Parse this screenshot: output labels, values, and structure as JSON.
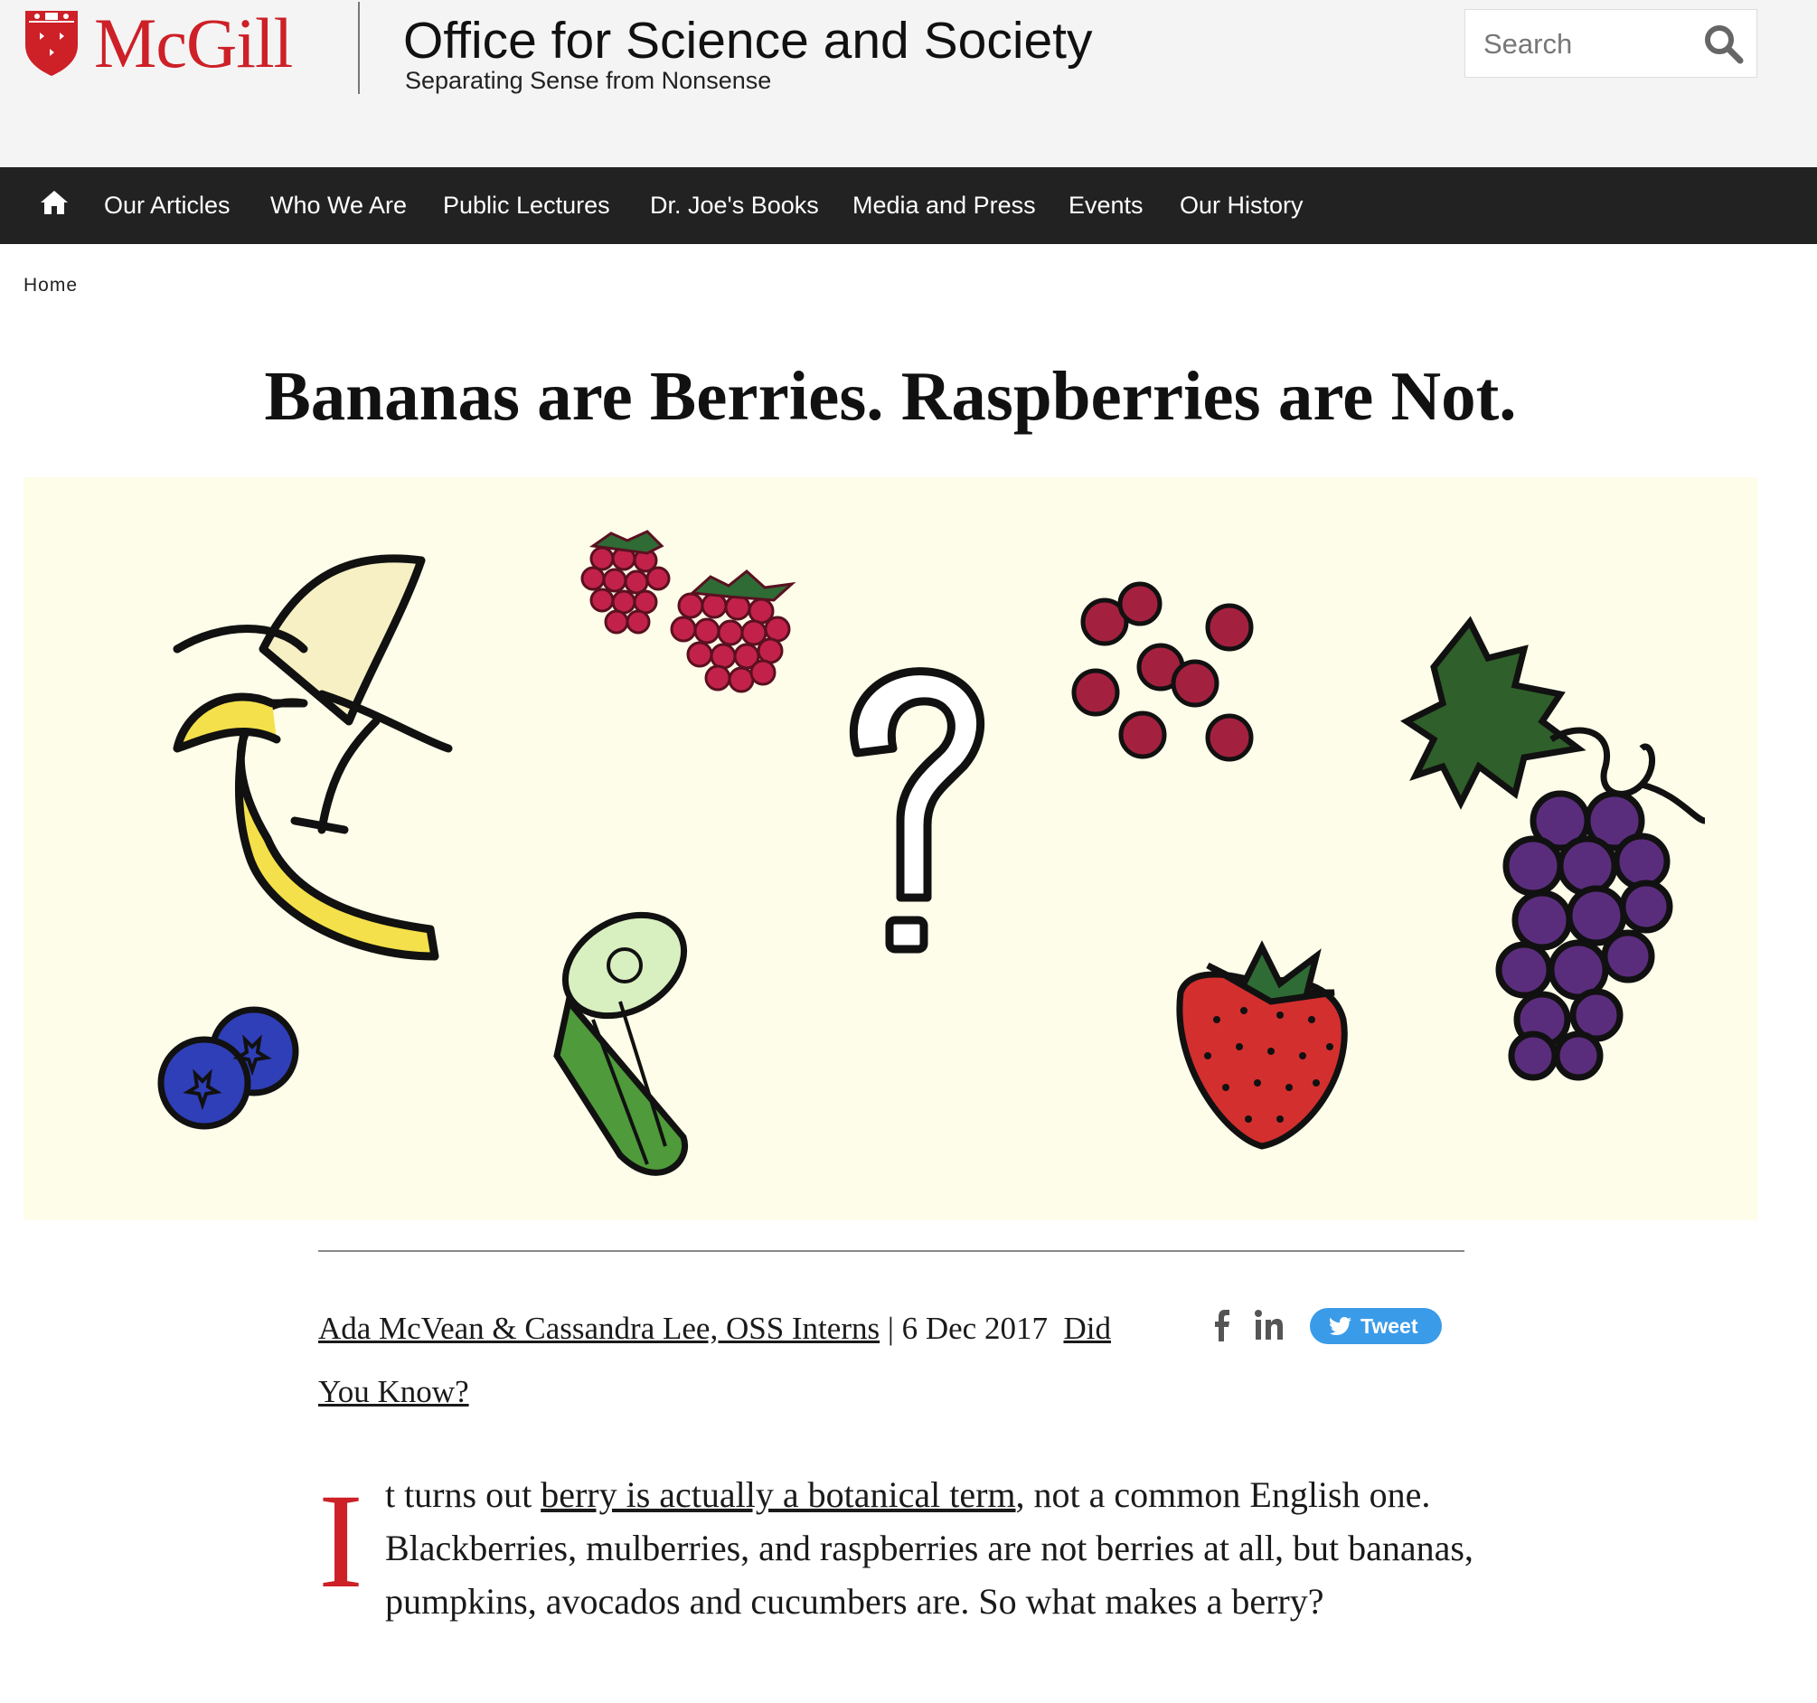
{
  "header": {
    "brand": "McGill",
    "site_title": "Office for Science and Society",
    "site_subtitle": "Separating Sense from Nonsense",
    "search_placeholder": "Search"
  },
  "nav": {
    "items": [
      "Our Articles",
      "Who We Are",
      "Public Lectures",
      "Dr. Joe's Books",
      "Media and Press",
      "Events",
      "Our History"
    ]
  },
  "breadcrumb": "Home",
  "article": {
    "title": "Bananas are Berries. Raspberries are Not.",
    "authors": "Ada McVean & Cassandra Lee, OSS Interns",
    "date_separator": " | ",
    "date": "6 Dec 2017",
    "category": "Did You Know?",
    "tweet_label": "Tweet",
    "dropcap": "I",
    "intro_before_link": "t turns out ",
    "intro_link": "berry is actually a botanical term",
    "intro_after_link": ", not a common English one. Blackberries, mulberries, and raspberries are not berries at all, but bananas, pumpkins, avocados and cucumbers are. So what makes a berry?"
  },
  "colors": {
    "brand_red": "#cd2027",
    "nav_bg": "#222222",
    "header_bg": "#f4f4f4",
    "hero_bg": "#fdfde9",
    "tweet_blue": "#3a9be8"
  },
  "icons": [
    "mcgill-crest-icon",
    "search-icon",
    "home-icon",
    "facebook-icon",
    "linkedin-icon",
    "twitter-bird-icon"
  ]
}
